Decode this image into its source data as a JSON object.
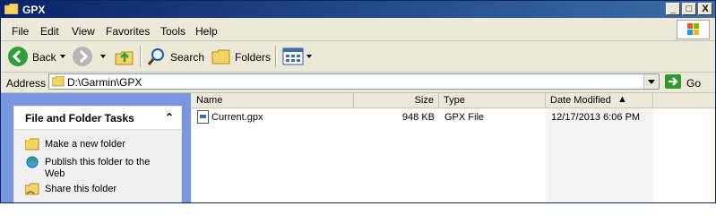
{
  "window": {
    "title": "GPX",
    "controls": {
      "minimize": "_",
      "maximize": "□",
      "close": "X"
    }
  },
  "menu": {
    "items": [
      {
        "label": "File"
      },
      {
        "label": "Edit"
      },
      {
        "label": "View"
      },
      {
        "label": "Favorites"
      },
      {
        "label": "Tools"
      },
      {
        "label": "Help"
      }
    ]
  },
  "toolbar": {
    "back_label": "Back",
    "search_label": "Search",
    "folders_label": "Folders"
  },
  "address": {
    "label": "Address",
    "value": "D:\\Garmin\\GPX",
    "go_label": "Go"
  },
  "tasks": {
    "title": "File and Folder Tasks",
    "items": [
      {
        "label": "Make a new folder",
        "icon": "new-folder-icon"
      },
      {
        "label": "Publish this folder to the Web",
        "icon": "publish-web-icon"
      },
      {
        "label": "Share this folder",
        "icon": "share-folder-icon"
      }
    ]
  },
  "filelist": {
    "columns": {
      "name": "Name",
      "size": "Size",
      "type": "Type",
      "date": "Date Modified"
    },
    "rows": [
      {
        "name": "Current.gpx",
        "size": "948 KB",
        "type": "GPX File",
        "date": "12/17/2013 6:06 PM"
      }
    ]
  },
  "colors": {
    "title_bar": "#0a246a",
    "task_pane": "#7a96df",
    "go_button": "#2e9a2e"
  }
}
